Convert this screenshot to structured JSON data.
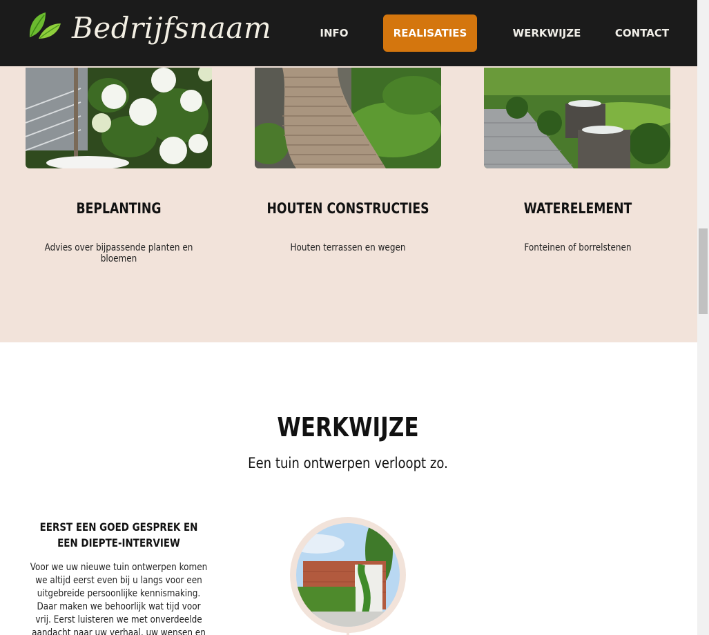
{
  "header": {
    "brand": "Bedrijfsnaam",
    "logo_icon": "leaf-icon",
    "nav": {
      "info": "INFO",
      "realisaties": "REALISATIES",
      "werkwijze": "WERKWIJZE",
      "contact": "CONTACT"
    },
    "active_nav": "REALISATIES",
    "colors": {
      "bar": "#1b1b1b",
      "accent": "#d4760e"
    }
  },
  "services": {
    "background": "#f2e3da",
    "items": [
      {
        "title": "BEPLANTING",
        "description": "Advies over bijpassende planten en bloemen",
        "image": "hydrangea-photo"
      },
      {
        "title": "HOUTEN CONSTRUCTIES",
        "description": "Houten terrassen en wegen",
        "image": "wooden-path-photo"
      },
      {
        "title": "WATERELEMENT",
        "description": "Fonteinen of borrelstenen",
        "image": "fountain-garden-photo"
      }
    ]
  },
  "werkwijze": {
    "title": "WERKWIJZE",
    "subtitle": "Een tuin ontwerpen verloopt zo.",
    "steps": [
      {
        "title": "EERST EEN GOED GESPREK EN EEN DIEPTE-INTERVIEW",
        "text": "Voor we uw nieuwe tuin ontwerpen komen we altijd eerst even bij u langs voor een uitgebreide persoonlijke kennismaking. Daar maken we behoorlijk wat tijd voor vrij. Eerst luisteren we met onverdeelde aandacht naar uw verhaal, uw wensen en verwachtingen. Vervolgens gaan we u",
        "image": "house-photo"
      }
    ]
  }
}
